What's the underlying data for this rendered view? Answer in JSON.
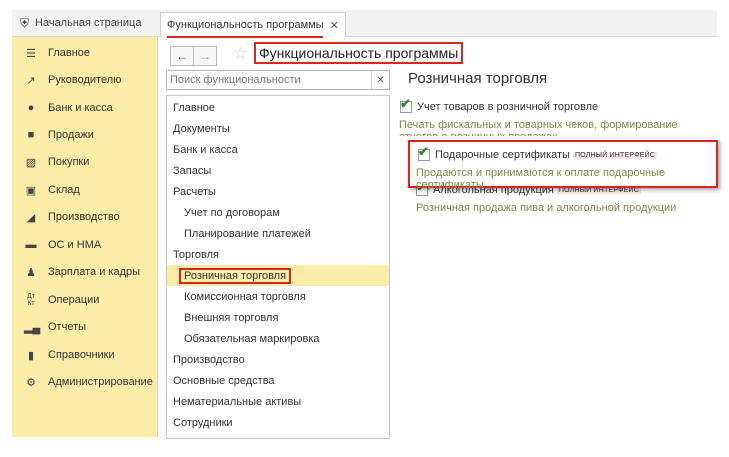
{
  "tabs": {
    "home_label": "Начальная страница",
    "active_label": "Функциональность программы"
  },
  "sidebar": {
    "items": [
      {
        "label": "Главное",
        "icon": "menu-icon"
      },
      {
        "label": "Руководителю",
        "icon": "trend-icon"
      },
      {
        "label": "Банк и касса",
        "icon": "coin-icon"
      },
      {
        "label": "Продажи",
        "icon": "briefcase-icon"
      },
      {
        "label": "Покупки",
        "icon": "cart-icon"
      },
      {
        "label": "Склад",
        "icon": "warehouse-icon"
      },
      {
        "label": "Производство",
        "icon": "factory-icon"
      },
      {
        "label": "ОС и НМА",
        "icon": "truck-icon"
      },
      {
        "label": "Зарплата и кадры",
        "icon": "person-icon"
      },
      {
        "label": "Операции",
        "icon": "dt-kt-icon"
      },
      {
        "label": "Отчеты",
        "icon": "bar-chart-icon"
      },
      {
        "label": "Справочники",
        "icon": "book-icon"
      },
      {
        "label": "Администрирование",
        "icon": "gear-icon"
      }
    ]
  },
  "header": {
    "title": "Функциональность программы"
  },
  "search": {
    "placeholder": "Поиск функциональности"
  },
  "tree": {
    "items": [
      {
        "label": "Главное"
      },
      {
        "label": "Документы"
      },
      {
        "label": "Банк и касса"
      },
      {
        "label": "Запасы"
      },
      {
        "label": "Расчеты"
      },
      {
        "label": "Учет по договорам"
      },
      {
        "label": "Планирование платежей"
      },
      {
        "label": "Торговля"
      },
      {
        "label": "Розничная торговля"
      },
      {
        "label": "Комиссионная торговля"
      },
      {
        "label": "Внешняя торговля"
      },
      {
        "label": "Обязательная маркировка"
      },
      {
        "label": "Производство"
      },
      {
        "label": "Основные средства"
      },
      {
        "label": "Нематериальные активы"
      },
      {
        "label": "Сотрудники"
      }
    ]
  },
  "content": {
    "section_title": "Розничная торговля",
    "options": [
      {
        "label": "Учет товаров в розничной торговле",
        "checked": true,
        "badge": "",
        "description": "Печать фискальных и товарных чеков, формирование отчетов о розничных продажах"
      },
      {
        "label": "Подарочные сертификаты",
        "checked": true,
        "badge": "ПОЛНЫЙ ИНТЕРФЕЙС",
        "description": "Продаются и принимаются к оплате подарочные сертификаты"
      },
      {
        "label": "Алкогольная продукция",
        "checked": true,
        "badge": "ПОЛНЫЙ ИНТЕРФЕЙС",
        "description": "Розничная продажа пива и алкогольной продукции"
      }
    ]
  },
  "colors": {
    "sidebar_bg": "#fbeca8",
    "highlight_red": "#d9251d",
    "check_green": "#2e8b2e"
  }
}
